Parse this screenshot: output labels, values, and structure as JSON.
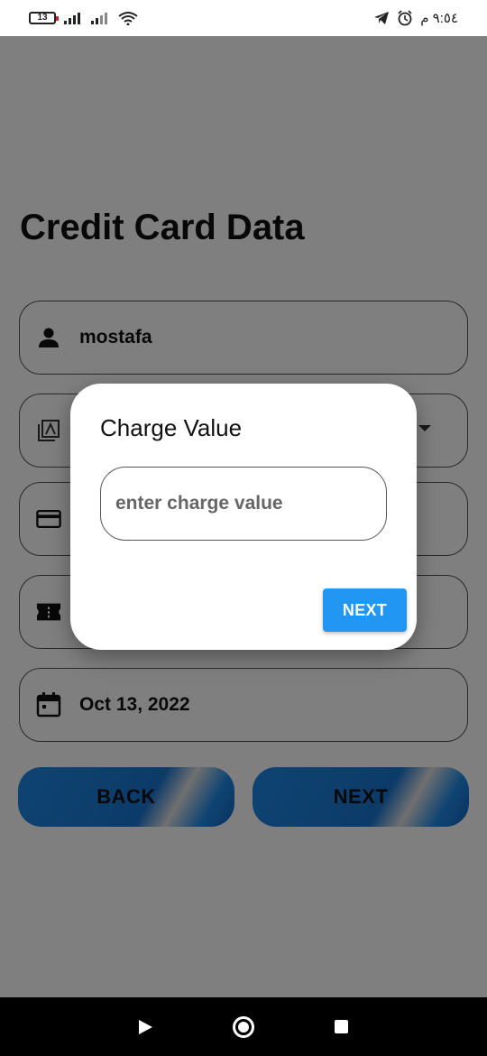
{
  "status_bar": {
    "battery": "13",
    "time": "٩:٥٤ م"
  },
  "page": {
    "title": "Credit Card Data",
    "fields": {
      "name": "mostafa",
      "date": "Oct 13, 2022"
    },
    "buttons": {
      "back": "BACK",
      "next": "NEXT"
    }
  },
  "dialog": {
    "title": "Charge Value",
    "input_placeholder": "enter charge value",
    "input_value": "",
    "next_label": "NEXT"
  },
  "icons": {
    "person": "person-icon",
    "card_type": "card-type-icon",
    "credit_card": "credit-card-icon",
    "ticket": "ticket-icon",
    "calendar": "calendar-icon"
  },
  "colors": {
    "accent": "#2196f3",
    "gradient_blue": "#1976d2"
  }
}
